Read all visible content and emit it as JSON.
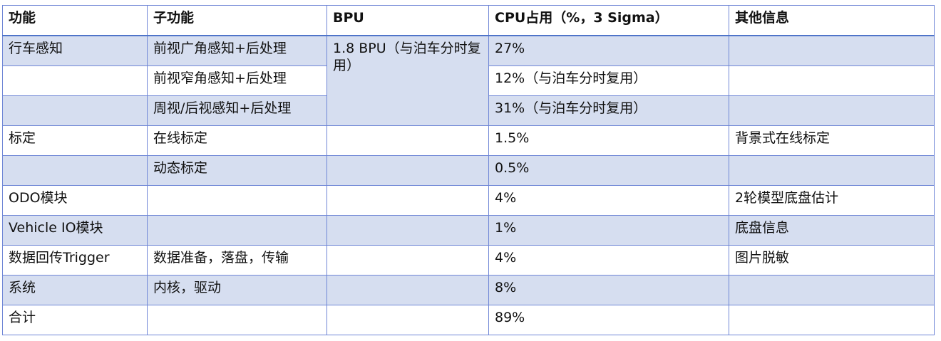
{
  "table": {
    "headers": [
      "功能",
      "子功能",
      "BPU",
      "CPU占用（%，3 Sigma）",
      "其他信息"
    ],
    "rows": [
      {
        "func": "行车感知",
        "sub": "前视广角感知+后处理",
        "bpu": "1.8 BPU（与泊车分时复用）",
        "cpu": "27%",
        "info": ""
      },
      {
        "func": "",
        "sub": "前视窄角感知+后处理",
        "cpu": "12%（与泊车分时复用）",
        "info": ""
      },
      {
        "func": "",
        "sub": "周视/后视感知+后处理",
        "cpu": "31%（与泊车分时复用）",
        "info": ""
      },
      {
        "func": "标定",
        "sub": "在线标定",
        "bpu": "",
        "cpu": "1.5%",
        "info": "背景式在线标定"
      },
      {
        "func": "",
        "sub": "动态标定",
        "bpu": "",
        "cpu": "0.5%",
        "info": ""
      },
      {
        "func": "ODO模块",
        "sub": "",
        "bpu": "",
        "cpu": "4%",
        "info": "2轮模型底盘估计"
      },
      {
        "func": "Vehicle IO模块",
        "sub": "",
        "bpu": "",
        "cpu": "1%",
        "info": "底盘信息"
      },
      {
        "func": "数据回传Trigger",
        "sub": "数据准备，落盘，传输",
        "bpu": "",
        "cpu": "4%",
        "info": "图片脱敏"
      },
      {
        "func": "系统",
        "sub": "内核，驱动",
        "bpu": "",
        "cpu": "8%",
        "info": ""
      },
      {
        "func": "合计",
        "sub": "",
        "bpu": "",
        "cpu": "89%",
        "info": ""
      }
    ]
  },
  "colors": {
    "border": "#6f86d6",
    "shade": "#d6def0",
    "header_rule": "#4f74c9"
  }
}
